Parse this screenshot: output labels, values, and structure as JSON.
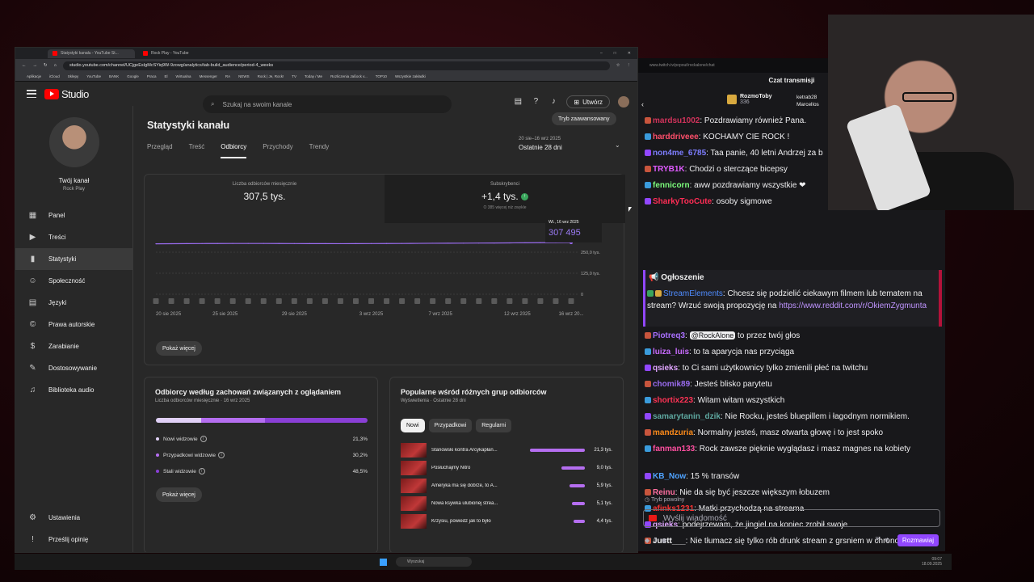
{
  "browser": {
    "tabs": [
      "Statystyki kanału - YouTube St...",
      "Rock Play - YouTube"
    ],
    "url": "studio.youtube.com/channel/UCjgeEsIgMcSYiq9W-9zowg/analytics/tab-build_audience/period-4_weeks",
    "bookmarks": [
      "Aplikacje",
      "iCloud",
      "Sklepy",
      "YouTube",
      "BANK",
      "Google",
      "Praca",
      "El",
      "Wirtualna",
      "Messenger",
      "RA",
      "NEWS",
      "Rock | Je, Rock!",
      "TV",
      "Today / Me",
      "Rozliczenia Jaßock v...",
      "TOP10",
      "Wszystkie zakładki"
    ]
  },
  "yt": {
    "logo": "Studio",
    "search_placeholder": "Szukaj na swoim kanale",
    "create_label": "Utwórz",
    "channel_title": "Twój kanał",
    "channel_name": "Rock Play",
    "nav": [
      {
        "label": "Panel",
        "icon": "dashboard-icon",
        "glyph": "▦"
      },
      {
        "label": "Treści",
        "icon": "content-icon",
        "glyph": "▶"
      },
      {
        "label": "Statystyki",
        "icon": "analytics-icon",
        "glyph": "▮"
      },
      {
        "label": "Społeczność",
        "icon": "community-icon",
        "glyph": "☺"
      },
      {
        "label": "Języki",
        "icon": "subtitles-icon",
        "glyph": "▤"
      },
      {
        "label": "Prawa autorskie",
        "icon": "copyright-icon",
        "glyph": "©"
      },
      {
        "label": "Zarabianie",
        "icon": "earn-icon",
        "glyph": "$"
      },
      {
        "label": "Dostosowywanie",
        "icon": "customization-icon",
        "glyph": "✎"
      },
      {
        "label": "Biblioteka audio",
        "icon": "audio-library-icon",
        "glyph": "♫"
      }
    ],
    "settings_label": "Ustawienia",
    "feedback_label": "Prześlij opinię",
    "page_title": "Statystyki kanału",
    "advanced_mode": "Tryb zaawansowany",
    "tabs": [
      "Przegląd",
      "Treść",
      "Odbiorcy",
      "Przychody",
      "Trendy"
    ],
    "date_range": "20 sie–16 wrz 2025",
    "date_label": "Ostatnie 28 dni",
    "metric1_label": "Liczba odbiorców miesięcznie",
    "metric1_value": "307,5 tys.",
    "metric2_label": "Subskrybenci",
    "metric2_value": "+1,4 tys.",
    "metric2_note": "O 385 więcej niż zwykle",
    "tooltip_date": "Wt., 16 wrz 2025",
    "tooltip_value": "307 495",
    "show_more": "Pokaż więcej",
    "card2_title": "Odbiorcy według zachowań związanych z oglądaniem",
    "card2_sub": "Liczba odbiorców miesięcznie · 16 wrz 2025",
    "segments": [
      {
        "label": "Nowi widzowie",
        "pct": "21,3%",
        "value": 21.3,
        "color": "#e0d0f6"
      },
      {
        "label": "Przypadkowi widzowie",
        "pct": "30,2%",
        "value": 30.2,
        "color": "#b56ef0"
      },
      {
        "label": "Stali widzowie",
        "pct": "48,5%",
        "value": 48.5,
        "color": "#8a3fd6"
      }
    ],
    "card3_title": "Popularne wśród różnych grup odbiorców",
    "card3_sub": "Wyświetlenia · Ostatnie 28 dni",
    "pills": [
      "Nowi",
      "Przypadkowi",
      "Regularni"
    ],
    "videos": [
      {
        "title": "Stanowski kontra Arcykapłan...",
        "value": 21.3,
        "label": "21,3 tys."
      },
      {
        "title": "Posłuchajmy Nitro",
        "value": 9.0,
        "label": "9,0 tys."
      },
      {
        "title": "Ameryka ma się dobrze, to A...",
        "value": 5.9,
        "label": "5,9 tys."
      },
      {
        "title": "Nowa ksywka ulubionej strea...",
        "value": 5.1,
        "label": "5,1 tys."
      },
      {
        "title": "Krzysiu, powiedz jak to było",
        "value": 4.4,
        "label": "4,4 tys."
      }
    ]
  },
  "chart_data": {
    "type": "line",
    "x_tick_labels": [
      "20 sie 2025",
      "25 sie 2025",
      "29 sie 2025",
      "3 wrz 2025",
      "7 wrz 2025",
      "12 wrz 2025",
      "16 wrz 20..."
    ],
    "y_tick_labels": [
      "250,0 tys.",
      "125,0 tys.",
      "0"
    ],
    "ylim": [
      0,
      375000
    ],
    "series": [
      {
        "values": [
          300000,
          300500,
          301000,
          301500,
          301800,
          302000,
          302100,
          302000,
          301700,
          301400,
          301200,
          301000,
          300900,
          301000,
          301300,
          301700,
          302100,
          302600,
          303100,
          303500,
          303900,
          304300,
          304800,
          305400,
          306000,
          306600,
          307000,
          307495
        ]
      }
    ],
    "color": "#9b6cf0"
  },
  "taskbar": {
    "search_placeholder": "Wyszukaj",
    "time": "09:07",
    "date": "18.09.2025"
  },
  "chat": {
    "url": "www.twitch.tv/popout/rockalone/chat",
    "title": "Czat transmisji",
    "gifter1_name": "RozmoToby",
    "gifter1_count": "336",
    "gifter2_name": "ketrab28",
    "gifter3_name": "Marcellos",
    "messages": [
      {
        "name": "mardsu1002",
        "color": "#d1335b",
        "text": ": Pozdrawiamy również Pana."
      },
      {
        "name": "harddriveee",
        "color": "#ff4f6b",
        "text": ": KOCHAMY CIE ROCK !"
      },
      {
        "name": "non4me_6785",
        "color": "#7d7dff",
        "text": ": Taa panie, 40 letni Andrzej za b"
      },
      {
        "name": "TRYB1K",
        "color": "#e05bff",
        "text": ": Chodzi o sterczące bicepsy"
      },
      {
        "name": "fennicorn",
        "color": "#7cfc7c",
        "text": ": aww pozdrawiamy wszystkie ❤"
      },
      {
        "name": "SharkyTooCute",
        "color": "#ff2d55",
        "text": ": osoby sigmowe"
      }
    ],
    "announce_header": "📢 Ogłoszenie",
    "announce_name": "StreamElements",
    "announce_text": ": Chcesz się podzielić ciekawym filmem lub tematem na stream? Wrzuć swoją propozycję na",
    "announce_link": "https://www.reddit.com/r/OkiemZygmunta",
    "messages2": [
      {
        "name": "Piotreq3",
        "color": "#a970ff",
        "text": " to przez twój głos",
        "mention": "@RockAlone"
      },
      {
        "name": "luiza_luis",
        "color": "#c86bff",
        "text": ": to ta aparycja nas przyciąga"
      },
      {
        "name": "qsieks",
        "color": "#e0a5ff",
        "text": ": to Ci sami użytkownicy tylko zmienili płeć na twitchu"
      },
      {
        "name": "chomik89",
        "color": "#9b6cf0",
        "text": ": Jesteś blisko parytetu"
      },
      {
        "name": "shortix223",
        "color": "#ff3355",
        "text": ": Witam witam wszystkich"
      },
      {
        "name": "samarytanin_dzik",
        "color": "#5ea8a0",
        "text": ": Nie Rocku, jesteś bluepillem i łagodnym normikiem."
      },
      {
        "name": "mandzuria",
        "color": "#ff8c1a",
        "text": ": Normalny jesteś, masz otwarta głowę i to jest spoko"
      },
      {
        "name": "fanman133",
        "color": "#ff4fa0",
        "text": ": Rock zawsze pięknie wyglądasz i masz magnes na kobiety"
      },
      {
        "name": "KB_Now",
        "color": "#4fa3ff",
        "text": ": 15 % transów"
      },
      {
        "name": "Reinu",
        "color": "#ff6fa0",
        "text": ": Nie da się być jeszcze większym łobuzem"
      },
      {
        "name": "afinks1231",
        "color": "#ff3333",
        "text": ": Matki przychodzą na streama"
      },
      {
        "name": "qsieks",
        "color": "#e0a5ff",
        "text": ": podejrzewam, że jingiel na koniec zrobił swoje"
      },
      {
        "name": "Justt___",
        "color": "#efeff1",
        "text": ": Nie tłumacz się tylko rób drunk stream z grsniem w chronosa"
      }
    ],
    "slow_mode": "Tryb powolny",
    "input_placeholder": "Wyślij wiadomość",
    "points": "0",
    "send_label": "Rozmawiaj"
  }
}
